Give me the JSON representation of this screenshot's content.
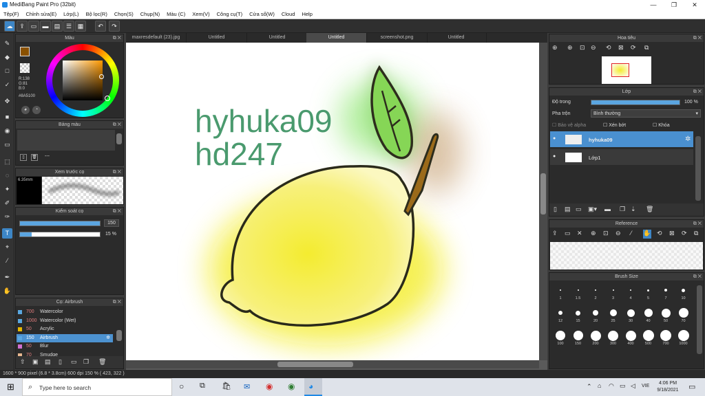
{
  "window": {
    "title": "MediBang Paint Pro (32bit)",
    "minimize": "—",
    "restore": "❐",
    "close": "✕"
  },
  "menu": [
    "Tệp(F)",
    "Chỉnh sửa(E)",
    "Lớp(L)",
    "Bộ lọc(R)",
    "Chọn(S)",
    "Chụp(N)",
    "Màu (C)",
    "Xem(V)",
    "Công cụ(T)",
    "Cửa sổ(W)",
    "Cloud",
    "Help"
  ],
  "toolbar": {
    "undo_icon": "↶",
    "redo_icon": "↷"
  },
  "color_panel": {
    "title": "Màu",
    "r": "R:138",
    "g": "G:81",
    "b": "B:0",
    "hex": "#8A5100",
    "main_color": "#8A5100",
    "sub_color": "#E8A020"
  },
  "palette_panel": {
    "title": "Bảng màu",
    "dots": "---"
  },
  "preview_panel": {
    "title": "Xem trước cọ",
    "size": "6.35mm"
  },
  "brush_control": {
    "title": "Kiểm soát cọ",
    "size_value": "150",
    "opacity_value": "15 %",
    "size_fraction": 1.0,
    "opacity_fraction": 0.15
  },
  "brush_list": {
    "title": "Cọ: Airbrush",
    "items": [
      {
        "size": "700",
        "name": "Watercolor",
        "color": "#5aa7e0"
      },
      {
        "size": "1000",
        "name": "Watercolor (Wet)",
        "color": "#5aa7e0"
      },
      {
        "size": "50",
        "name": "Acrylic",
        "color": "#e8b800"
      },
      {
        "size": "150",
        "name": "Airbrush",
        "color": "#5aa7e0"
      },
      {
        "size": "50",
        "name": "Blur",
        "color": "#d070d0"
      },
      {
        "size": "70",
        "name": "Smudge",
        "color": "#e8b890"
      }
    ]
  },
  "tabs": [
    "maxresdefault (23).jpg",
    "Untitled",
    "Untitled",
    "Untitled",
    "screenshot.png",
    "Untitled"
  ],
  "canvas": {
    "text_line1": "hyhuka09",
    "text_line2": "hd247",
    "text_color": "#4a9a6e"
  },
  "navigator": {
    "title": "Hoa tiêu"
  },
  "layer_panel": {
    "title": "Lớp",
    "opacity_label": "Độ trong",
    "opacity_value": "100 %",
    "opacity_fraction": 1.0,
    "blend_label": "Pha trộn",
    "blend_value": "Bình thường",
    "protect_alpha": "Bảo vệ alpha",
    "clipping": "Xén bớt",
    "lock": "Khóa",
    "layers": [
      {
        "name": "hyhuka09"
      },
      {
        "name": "Lớp1"
      }
    ]
  },
  "reference": {
    "title": "Reference"
  },
  "brush_size": {
    "title": "Brush Size",
    "rows": [
      [
        "1",
        "1.5",
        "2",
        "3",
        "4",
        "5",
        "7",
        "10"
      ],
      [
        "12",
        "15",
        "20",
        "25",
        "30",
        "40",
        "50",
        "70"
      ],
      [
        "100",
        "150",
        "200",
        "300",
        "400",
        "500",
        "700",
        "1000"
      ]
    ]
  },
  "status": {
    "text": "1600 * 900 pixel   (6.8 * 3.8cm)   600 dpi   150 %   ( 423, 322 )"
  },
  "taskbar": {
    "search_placeholder": "Type here to search",
    "time": "4:06 PM",
    "date": "9/18/2021",
    "lang": "VIE"
  }
}
